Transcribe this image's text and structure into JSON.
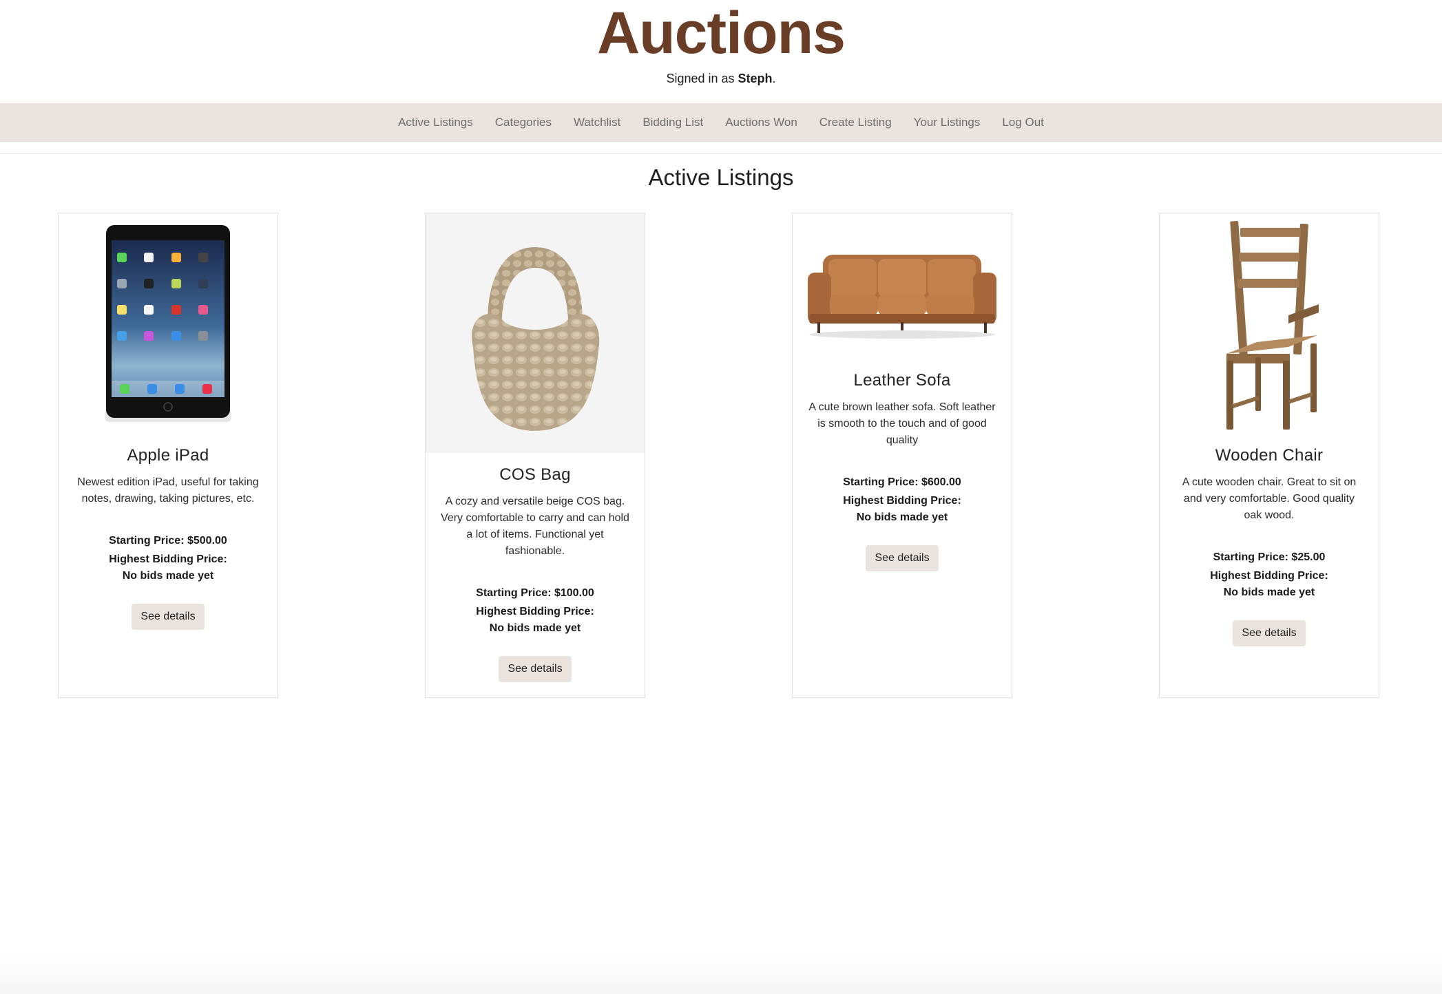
{
  "header": {
    "title": "Auctions",
    "signed_in_prefix": "Signed in as ",
    "username": "Steph",
    "signed_in_suffix": "."
  },
  "nav": [
    "Active Listings",
    "Categories",
    "Watchlist",
    "Bidding List",
    "Auctions Won",
    "Create Listing",
    "Your Listings",
    "Log Out"
  ],
  "page_heading": "Active Listings",
  "listings": [
    {
      "title": "Apple iPad",
      "description": "Newest edition iPad, useful for taking notes, drawing, taking pictures, etc.",
      "starting_price": "Starting Price: $500.00",
      "highest_bid_label": "Highest Bidding Price:",
      "highest_bid_value": "No bids made yet",
      "button": "See details",
      "image": "ipad-image"
    },
    {
      "title": "COS Bag",
      "description": "A cozy and versatile beige COS bag. Very comfortable to carry and can hold a lot of items. Functional yet fashionable.",
      "starting_price": "Starting Price: $100.00",
      "highest_bid_label": "Highest Bidding Price:",
      "highest_bid_value": "No bids made yet",
      "button": "See details",
      "image": "bag-image"
    },
    {
      "title": "Leather Sofa",
      "description": "A cute brown leather sofa. Soft leather is smooth to the touch and of good quality",
      "starting_price": "Starting Price: $600.00",
      "highest_bid_label": "Highest Bidding Price:",
      "highest_bid_value": "No bids made yet",
      "button": "See details",
      "image": "sofa-image"
    },
    {
      "title": "Wooden Chair",
      "description": "A cute wooden chair. Great to sit on and very comfortable. Good quality oak wood.",
      "starting_price": "Starting Price: $25.00",
      "highest_bid_label": "Highest Bidding Price:",
      "highest_bid_value": "No bids made yet",
      "button": "See details",
      "image": "chair-image"
    }
  ],
  "colors": {
    "brand": "#6a3d26",
    "nav_bg": "#ebe3dd",
    "button_bg": "#ebe3dd"
  }
}
